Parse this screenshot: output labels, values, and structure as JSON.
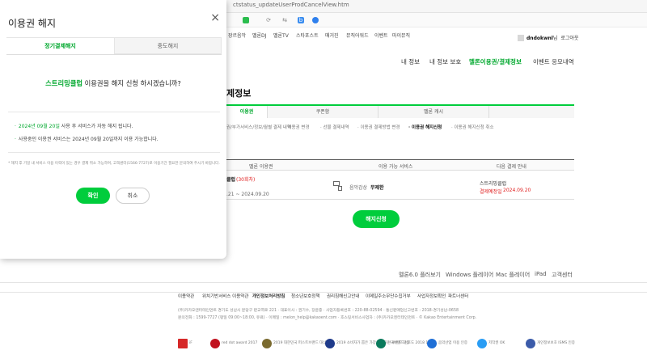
{
  "browser": {
    "url": "ctstatus_updateUserProdCancelView.htm",
    "bookmark_icons": [
      "green-square-icon",
      "refresh-icon",
      "sync-icon",
      "bookmark-b-icon",
      "chat-icon"
    ]
  },
  "gnb": [
    "장르음악",
    "멜론DJ",
    "멜론TV",
    "스타포스트",
    "매거진",
    "뮤직어워드",
    "이벤트",
    "마이뮤직"
  ],
  "user": {
    "name": "dndokwnl",
    "suffix": "님",
    "logout": "로그아웃"
  },
  "submenu": [
    {
      "label": "내 정보",
      "active": false
    },
    {
      "label": "내 정보 보호",
      "active": false
    },
    {
      "label": "멜론이용권/결제정보",
      "active": true
    },
    {
      "label": "이벤트 응모내역",
      "active": false
    }
  ],
  "page_title": "제정보",
  "main_tabs": [
    {
      "label": "이용권",
      "active": true
    },
    {
      "label": "쿠폰함",
      "active": false
    },
    {
      "label": "멜론 캐시",
      "active": false
    },
    {
      "label": "",
      "active": false
    }
  ],
  "sub_tabs": [
    {
      "label": "권/부가서비스/정보/월별 결제 내역",
      "active": false
    },
    {
      "label": "· 이용권 변경",
      "active": false
    },
    {
      "label": "· 선물 결제내역",
      "active": false
    },
    {
      "label": "· 이용권 결제방법 변경",
      "active": false
    },
    {
      "label": "· 이용권 해지신청",
      "active": true
    },
    {
      "label": "· 이용권 해지신청 취소",
      "active": false
    }
  ],
  "table": {
    "headers": [
      "멜론 이용권",
      "이용 가능 서비스",
      "다음 결제 안내"
    ],
    "row": {
      "product": "클럽",
      "product_tag": "(30회차)",
      "period": ".21 ~ 2024.09.20",
      "service_label": "음악감상",
      "service_value": "무제한",
      "next_pay_title": "스트리밍클럽",
      "next_pay_label": "결제예정일",
      "next_pay_date": "2024.09.20"
    }
  },
  "cancel_button": "해지신청",
  "footer_nav": [
    "멜론6.0 플러보기",
    "Windows 플레이어",
    "Mac 플레이어",
    "iPad",
    "고객센터"
  ],
  "footer_links": [
    "이용약관",
    "위치기반서비스 이용약관",
    "개인정보처리방침",
    "청소년보호정책",
    "권리침해신고안내",
    "이메일주소무단수집거부",
    "사업자정보확인",
    "파트너센터"
  ],
  "footer_info": [
    "(주)카카오엔터테인먼트 경기도 성남시 분당구 판교역로 221 · 대표이사 : 권기수, 장윤중 · 사업자등록번호 : 220-88-02594 · 통신판매업신고번호 : 2018-경기성남-0658",
    "문의전화 : 1599-7727 (평일 09:00~18:00, 유료) · 이메일 : melon_help@kakaoent.com · 호스팅서비스사업자 : (주)카카오엔터테인먼트 · © Kakao Entertainment Corp."
  ],
  "award_badges": [
    {
      "caption": "iF",
      "color": "#d62828"
    },
    {
      "caption": "red dot award 2017",
      "color": "#c1121f"
    },
    {
      "caption": "2019 대한민국 퍼스트브랜드 대상",
      "color": "#7a6a2f"
    },
    {
      "caption": "2019 소비자가 뽑은 가장 신뢰하는 브랜드 대상",
      "color": "#1e3a8a"
    },
    {
      "caption": "한국브랜드선호도 2018 1위",
      "color": "#0b7a5c"
    },
    {
      "caption": "음악산업 이용 인증",
      "color": "#1f6fd6"
    },
    {
      "caption": "저작권 OK",
      "color": "#2a9df4"
    },
    {
      "caption": "개인정보보호 ISMS 인증",
      "color": "#3b5ba9"
    }
  ],
  "dialog": {
    "title": "이용권 해지",
    "tab_active": "정기결제해지",
    "tab_inactive": "중도해지",
    "question_product": "스트리밍클럽",
    "question_rest": " 이용권을 해지 신청 하시겠습니까?",
    "bullet1_date": "2024년 09월 20일",
    "bullet1_rest": " 사용 후 서비스가 자동 해지 됩니다.",
    "bullet2": "사용중인 이용권 서비스는 2024년 09월 20일까지 이용 가능합니다.",
    "note": "* 해지 후 기일 내 서비스 이용 이력이 있는 경우 결제 취소 가능하며, 고객센터(1566-7727)로 이용기간 필요한 문의하여 주시기 바랍니다.",
    "ok": "확인",
    "cancel": "취소"
  }
}
